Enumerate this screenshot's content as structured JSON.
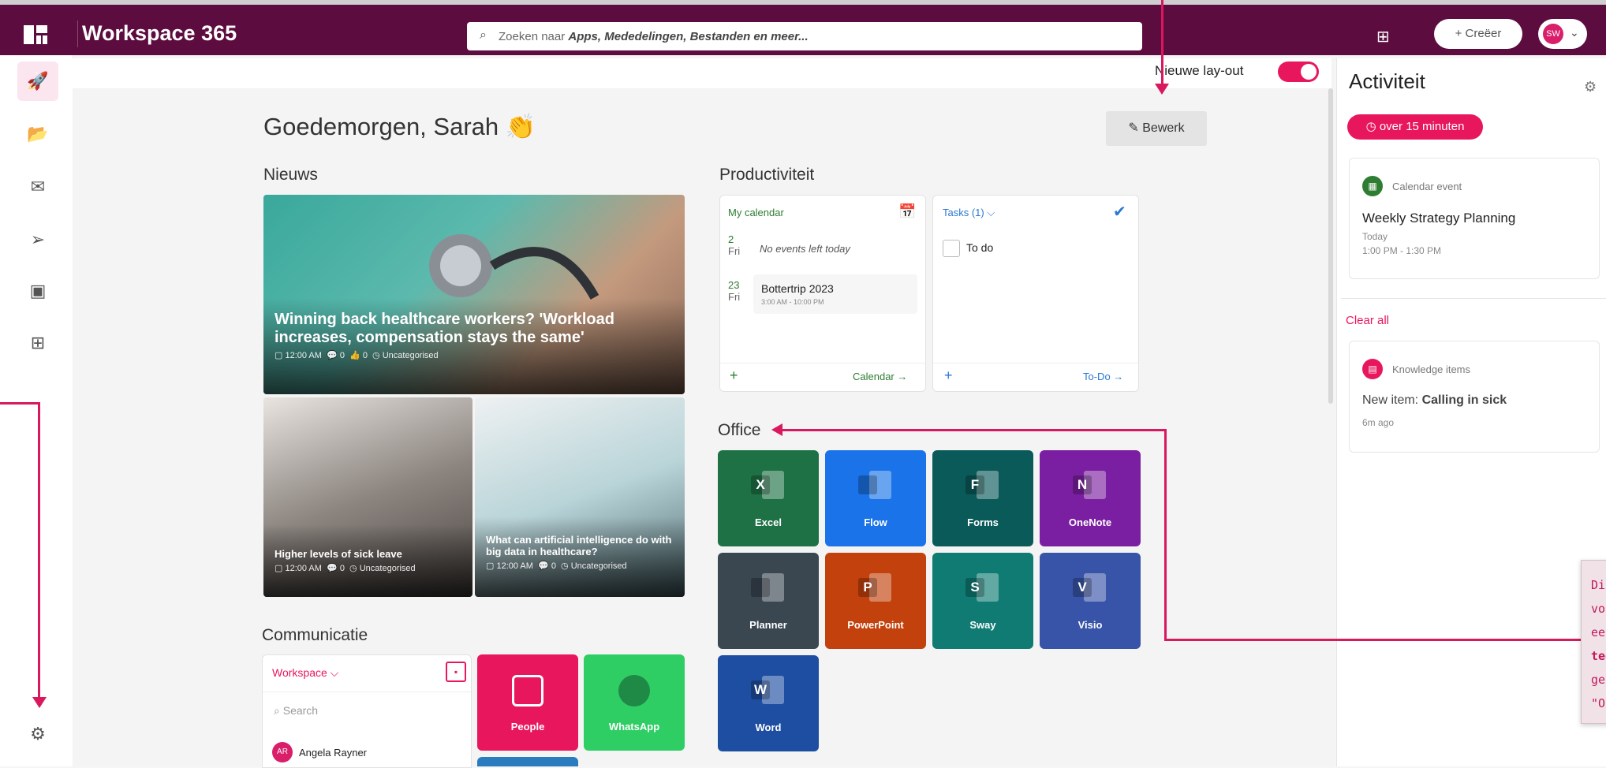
{
  "topbar": {
    "app_title": "Workspace 365",
    "search_placeholder_prefix": "Zoeken naar ",
    "search_placeholder_emph": "Apps, Mededelingen, Bestanden en meer...",
    "create_label": "+ Creëer",
    "user_initials": "SW"
  },
  "layout_toggle": {
    "label": "Nieuwe lay-out",
    "on": true
  },
  "greeting": "Goedemorgen, Sarah",
  "greeting_emoji": "👏",
  "edit_label": "Bewerk",
  "sections": {
    "news": "Nieuws",
    "productivity": "Productiviteit",
    "office": "Office",
    "communication": "Communicatie"
  },
  "news": [
    {
      "title": "Winning back healthcare workers? 'Workload increases, compensation stays the same'",
      "time": "12:00 AM",
      "comments": "0",
      "likes": "0",
      "category": "Uncategorised"
    },
    {
      "title": "Higher levels of sick leave",
      "time": "12:00 AM",
      "comments": "0",
      "category": "Uncategorised"
    },
    {
      "title": "What can artificial intelligence do with big data in healthcare?",
      "time": "12:00 AM",
      "comments": "0",
      "category": "Uncategorised"
    }
  ],
  "calendar": {
    "title": "My calendar",
    "rows": [
      {
        "day": "2",
        "weekday": "Fri",
        "text": "No events left today",
        "time": ""
      },
      {
        "day": "23",
        "weekday": "Fri",
        "text": "Bottertrip 2023",
        "time": "3:00 AM - 10:00 PM"
      }
    ],
    "add": "+",
    "link": "Calendar →"
  },
  "tasks": {
    "title": "Tasks (1) ⌵",
    "items": [
      "To do"
    ],
    "add": "+",
    "link": "To-Do →"
  },
  "office_apps": [
    {
      "name": "Excel",
      "color": "#1e7145",
      "letter": "X"
    },
    {
      "name": "Flow",
      "color": "#1a73e8",
      "letter": ""
    },
    {
      "name": "Forms",
      "color": "#0b5a5a",
      "letter": "F"
    },
    {
      "name": "OneNote",
      "color": "#7b1fa2",
      "letter": "N"
    },
    {
      "name": "Planner",
      "color": "#3a4650",
      "letter": ""
    },
    {
      "name": "PowerPoint",
      "color": "#c2410c",
      "letter": "P"
    },
    {
      "name": "Sway",
      "color": "#0f7b73",
      "letter": "S"
    },
    {
      "name": "Visio",
      "color": "#3854a8",
      "letter": "V"
    },
    {
      "name": "Word",
      "color": "#1e4ea1",
      "letter": "W"
    }
  ],
  "communication": {
    "dropdown": "Workspace ⌵",
    "search_placeholder": "Search",
    "contact_initials": "AR",
    "contact": "Angela Rayner",
    "tiles": [
      {
        "name": "People",
        "color": "#e8175d"
      },
      {
        "name": "WhatsApp",
        "color": "#2fce65"
      }
    ]
  },
  "activity": {
    "title": "Activiteit",
    "time_chip": "over 15 minuten",
    "event": {
      "type": "Calendar event",
      "title": "Weekly Strategy Planning",
      "day": "Today",
      "time": "1:00 PM - 1:30 PM"
    },
    "clear_all": "Clear all",
    "knowledge": {
      "type": "Knowledge items",
      "prefix": "New item: ",
      "title": "Calling in sick",
      "ago": "6m ago"
    }
  },
  "tooltip": {
    "lines": [
      "Dit",
      "voo",
      "een",
      "tege",
      "gen",
      "\"Off"
    ],
    "bold_index": 3
  },
  "colors": {
    "topbar": "#5c0c3e",
    "accent": "#e8175d",
    "annotation": "#d9185e"
  }
}
